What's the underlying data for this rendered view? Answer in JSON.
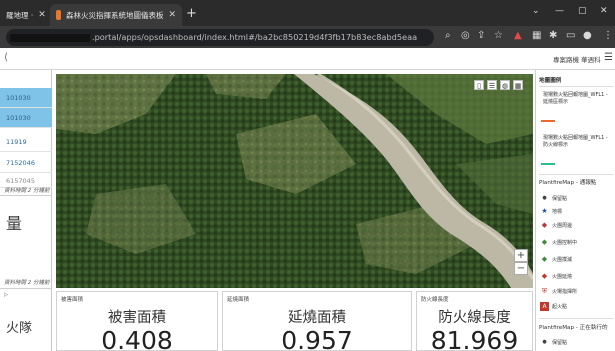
{
  "browser": {
    "tabs": [
      {
        "title": "羅地理 ·",
        "close": "✕"
      },
      {
        "title": "森林火災指揮系統地圖儀表板",
        "close": "✕"
      }
    ],
    "newtab": "+",
    "url": ".portal/apps/opsdashboard/index.html#/ba2bc850219d4f3fb17b83ec8abd5eaa",
    "window_controls": [
      "⌄",
      "—",
      "▢",
      "✕"
    ]
  },
  "app": {
    "user": "專案路機 華週科",
    "left_icon": "⟨",
    "menu_icon": "☰"
  },
  "left_panel": {
    "rows": [
      "101030",
      "101030",
      "11919",
      "7152046",
      "6157045"
    ],
    "note1": "資料時間 2 分鐘前",
    "big_char": "量",
    "note2": "資料時間 2 分鐘前",
    "arrow": "▷",
    "team": "火隊"
  },
  "cards": [
    {
      "small_title": "被害面積",
      "heading": "被害面積",
      "value": "0.408"
    },
    {
      "small_title": "延燒面積",
      "heading": "延燒面積",
      "value": "0.957"
    },
    {
      "small_title": "防火線長度",
      "heading": "防火線長度",
      "value": "81.969"
    }
  ],
  "legend": {
    "title": "地圖圖例",
    "layer1": "現場數火點回報地圖_WFL1 - 延燒區標示",
    "layer2": "現場數火點回報地圖_WFL1 - 防火線標示",
    "section2": "PlantfireMap - 通報點",
    "items": [
      {
        "icon": "●",
        "color": "#444",
        "label": "保留點"
      },
      {
        "icon": "★",
        "color": "#1f4fb3",
        "label": "地標"
      },
      {
        "icon": "◆",
        "color": "#b23a3a",
        "label": "火團周邊"
      },
      {
        "icon": "◆",
        "color": "#3e8a3e",
        "label": "火團控制中"
      },
      {
        "icon": "◆",
        "color": "#3e8a3e",
        "label": "火團撲滅"
      },
      {
        "icon": "◆",
        "color": "#c0392b",
        "label": "火團延燒"
      },
      {
        "icon": "⛨",
        "color": "#c0392b",
        "label": "火場指揮所"
      },
      {
        "icon": "A",
        "color": "#c0392b",
        "label": "起火點"
      }
    ],
    "section3": "PlantfireMap - 正在執行的",
    "last_item": "保留點",
    "colors": {
      "burn": "#e86a2c",
      "fireline": "#2bbf8a"
    }
  }
}
